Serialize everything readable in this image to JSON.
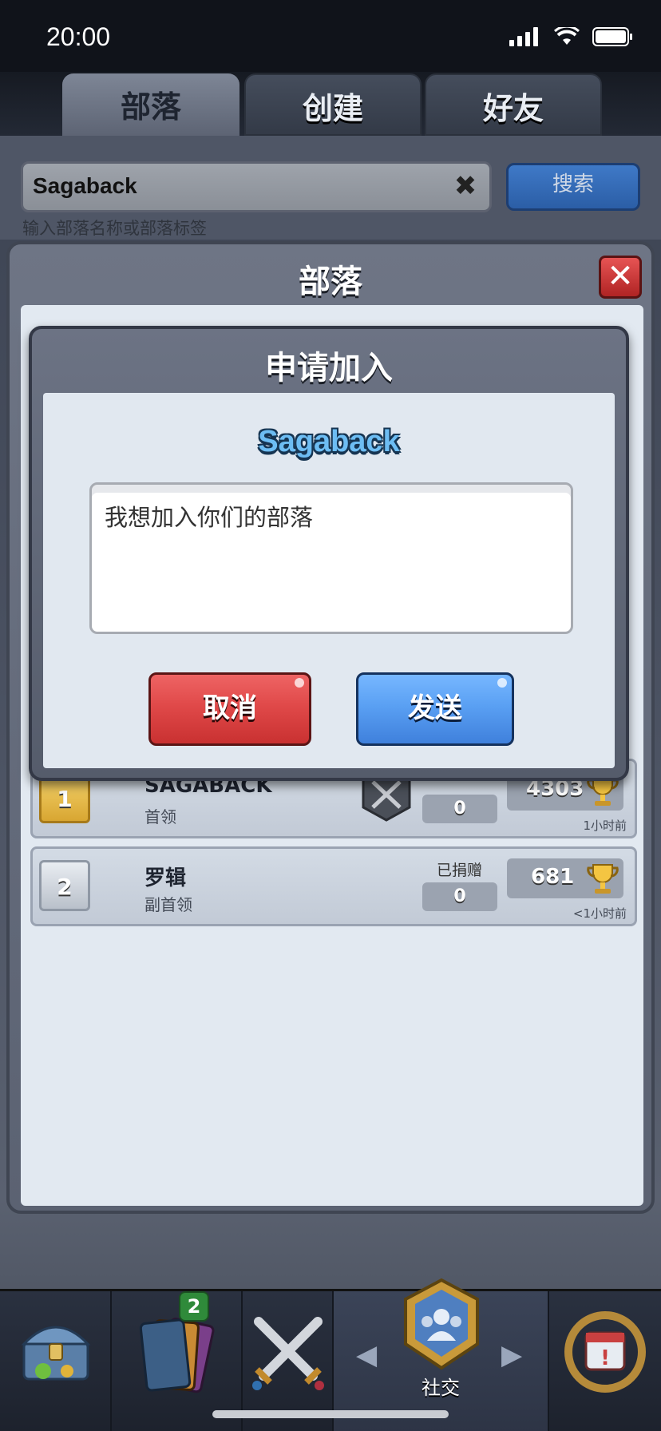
{
  "status_bar": {
    "time": "20:00"
  },
  "tabs": [
    {
      "label": "部落",
      "active": true
    },
    {
      "label": "创建",
      "active": false
    },
    {
      "label": "好友",
      "active": false
    }
  ],
  "search": {
    "value": "Sagaback",
    "button_label": "搜索",
    "hint": "输入部落名称或部落标签"
  },
  "clan_panel": {
    "title": "部落",
    "members": [
      {
        "rank": "1",
        "name": "SAGABACK",
        "role": "首领",
        "donated": "0",
        "trophies": "4303",
        "last_seen": "1小时前"
      },
      {
        "rank": "2",
        "name": "罗辑",
        "role": "副首领",
        "donated_label": "已捐赠",
        "donated": "0",
        "trophies": "681",
        "last_seen": "<1小时前"
      }
    ]
  },
  "join_dialog": {
    "title": "申请加入",
    "clan_name": "Sagaback",
    "message": "我想加入你们的部落",
    "cancel_label": "取消",
    "send_label": "发送"
  },
  "bottom_nav": {
    "items": [
      {
        "icon": "treasure-chest-icon"
      },
      {
        "icon": "cards-icon",
        "badge": "2"
      },
      {
        "icon": "crossed-swords-icon"
      },
      {
        "icon": "social-shield-icon",
        "label": "社交"
      },
      {
        "icon": "events-laurel-icon"
      }
    ]
  },
  "colors": {
    "cancel": "#e04949",
    "send": "#5aa0f3",
    "clan_name": "#6dbdf3",
    "rank_gold": "#d8a632"
  }
}
